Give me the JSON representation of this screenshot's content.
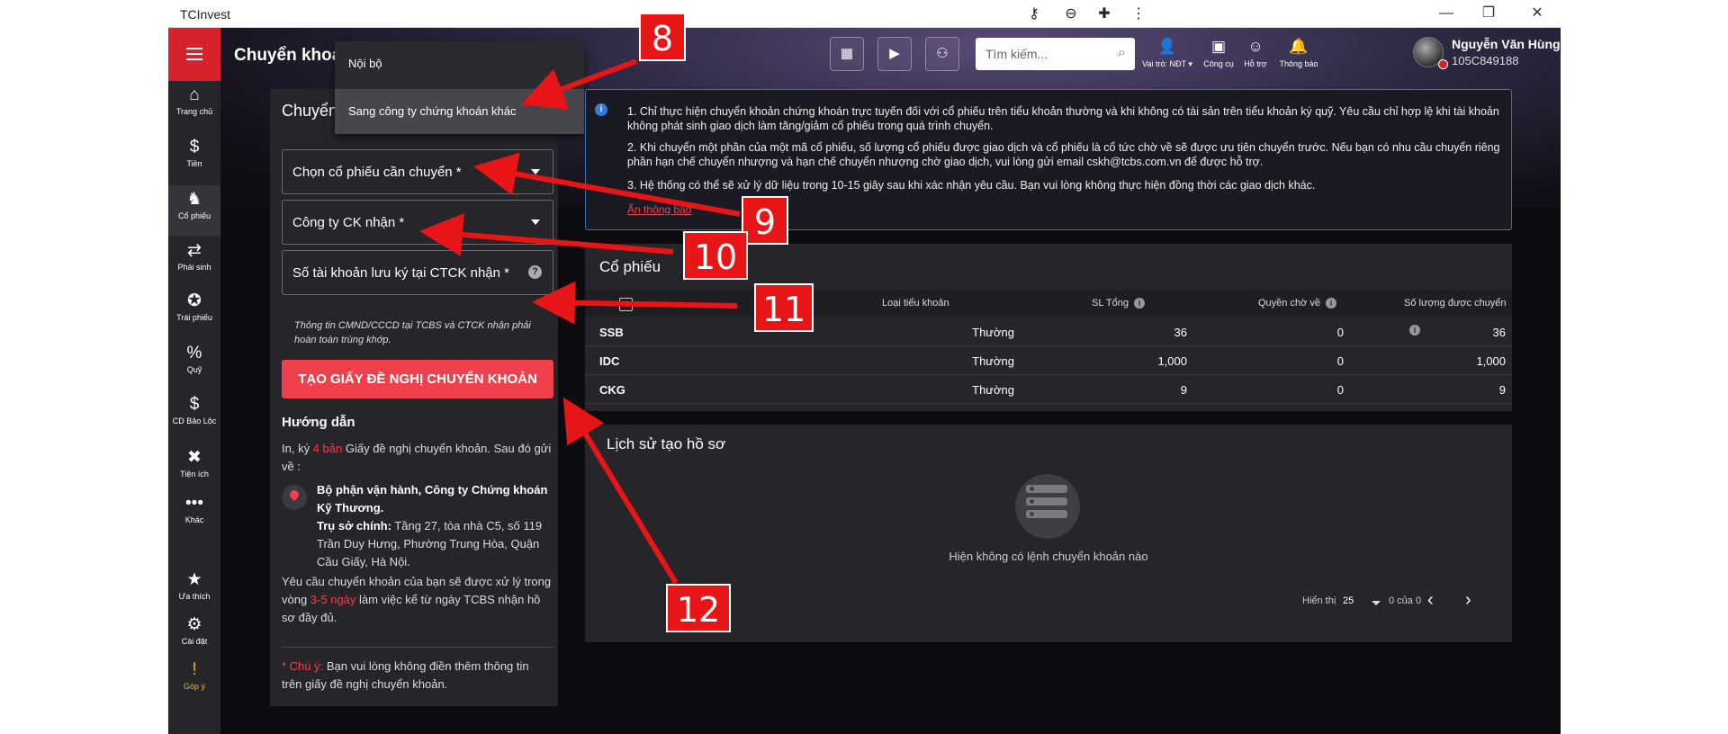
{
  "window": {
    "app_name": "TCInvest",
    "icons": [
      "key-icon",
      "zoom-out-icon",
      "puzzle-icon",
      "kebab-icon"
    ]
  },
  "sidebar": {
    "items": [
      {
        "label": "Trang chủ",
        "icon": "home-icon",
        "glyph": "⌂"
      },
      {
        "label": "Tiền",
        "icon": "money-icon",
        "glyph": "$"
      },
      {
        "label": "Cổ phiếu",
        "icon": "stock-icon",
        "glyph": "♞",
        "active": true
      },
      {
        "label": "Phái sinh",
        "icon": "derivative-icon",
        "glyph": "⇄"
      },
      {
        "label": "Trái phiếu",
        "icon": "bond-icon",
        "glyph": "✪"
      },
      {
        "label": "Quỹ",
        "icon": "fund-icon",
        "glyph": "%"
      },
      {
        "label": "CD Bảo Lộc",
        "icon": "cd-icon",
        "glyph": "$"
      },
      {
        "label": "Tiện ích",
        "icon": "tools-icon",
        "glyph": "✖"
      },
      {
        "label": "Khác",
        "icon": "more-icon",
        "glyph": "•••"
      },
      {
        "label": "Ưa thích",
        "icon": "star-icon",
        "glyph": "★"
      },
      {
        "label": "Cài đặt",
        "icon": "gear-icon",
        "glyph": "⚙"
      },
      {
        "label": "Góp ý",
        "icon": "feedback-icon",
        "glyph": "!"
      }
    ]
  },
  "header": {
    "title": "Chuyển khoả",
    "search_placeholder": "Tìm kiếm...",
    "role_label": "Vai trò: NĐT ▾",
    "tools_label": "Công cụ",
    "support_label": "Hỗ trợ",
    "notify_label": "Thông báo",
    "user_name": "Nguyễn Văn Hùng",
    "user_id": "105C849188"
  },
  "transfer_form": {
    "panel_title": "Chuyển",
    "dropdown_options": [
      "Nội bộ",
      "Sang công ty chứng khoán khác"
    ],
    "stock_select": "Chọn cổ phiếu cần chuyển *",
    "company_select": "Công ty CK nhận *",
    "account_input": "Số tài khoản lưu ký tại CTCK nhận *",
    "note": "Thông tin CMND/CCCD tại TCBS và CTCK nhận phải hoàn toàn trùng khớp.",
    "submit": "TẠO GIẤY ĐỀ NGHỊ CHUYỂN KHOẢN"
  },
  "guide": {
    "title": "Hướng dẫn",
    "p1_a": "In, ký ",
    "p1_red": "4 bản",
    "p1_b": " Giấy đề nghị chuyển khoản. Sau đó gửi về :",
    "office_name": "Bộ phận vận hành, Công ty Chứng khoán Kỹ Thương.",
    "hq_label": "Trụ sở chính:",
    "hq_address": " Tầng 27, tòa nhà C5, số 119 Trần Duy Hưng, Phường Trung Hòa, Quận Cầu Giấy, Hà Nội.",
    "p2_a": "Yêu cầu chuyển khoản của bạn sẽ được xử lý trong vòng ",
    "p2_red": "3-5 ngày",
    "p2_b": " làm việc kể từ ngày TCBS nhận hồ sơ đầy đủ.",
    "warn_red": "* Chú ý:",
    "warn_text": " Bạn vui lòng không điền thêm thông tin trên giấy đề nghị chuyển khoản."
  },
  "info": {
    "line1": "1. Chỉ thực hiện chuyển khoản chứng khoán trực tuyến đối với cổ phiếu trên tiểu khoản thường và khi không có tài sản trên tiểu khoản ký quỹ. Yêu cầu chỉ hợp lệ khi tài khoản không phát sinh giao dịch làm tăng/giảm cổ phiếu trong quá trình chuyển.",
    "line2": "2. Khi chuyển một phần của một mã cổ phiếu, số lượng cổ phiếu được giao dịch và cổ phiếu là cổ tức chờ về sẽ được ưu tiên chuyển trước. Nếu bạn có nhu cầu chuyển riêng phần hạn chế chuyển nhượng và hạn chế chuyển nhượng chờ giao dịch, vui lòng gửi email cskh@tcbs.com.vn để được hỗ trợ.",
    "line3": "3. Hệ thống có thể sẽ xử lý dữ liệu trong 10-15 giây sau khi xác nhận yêu cầu. Bạn vui lòng không thực hiện đồng thời các giao dịch khác.",
    "hide_link": "Ẩn thông báo"
  },
  "stocks": {
    "title": "Cổ phiếu",
    "columns": [
      "Loại tiểu khoản",
      "SL Tổng",
      "Quyền chờ về",
      "Số lượng được chuyển"
    ],
    "rows": [
      {
        "symbol": "SSB",
        "type": "Thường",
        "total": "36",
        "pending": "0",
        "transferable": "36"
      },
      {
        "symbol": "IDC",
        "type": "Thường",
        "total": "1,000",
        "pending": "0",
        "transferable": "1,000"
      },
      {
        "symbol": "CKG",
        "type": "Thường",
        "total": "9",
        "pending": "0",
        "transferable": "9"
      }
    ]
  },
  "history": {
    "title": "Lịch sử tạo hồ sơ",
    "empty": "Hiện không có lệnh chuyển khoản nào",
    "show_label": "Hiển thị",
    "page_size": "25",
    "range": "0 của 0"
  },
  "annotations": [
    "8",
    "9",
    "10",
    "11",
    "12"
  ],
  "colors": {
    "accent": "#d7222c",
    "cta": "#f0404c",
    "info_border": "#3b6db8",
    "annotation": "#e81517"
  }
}
